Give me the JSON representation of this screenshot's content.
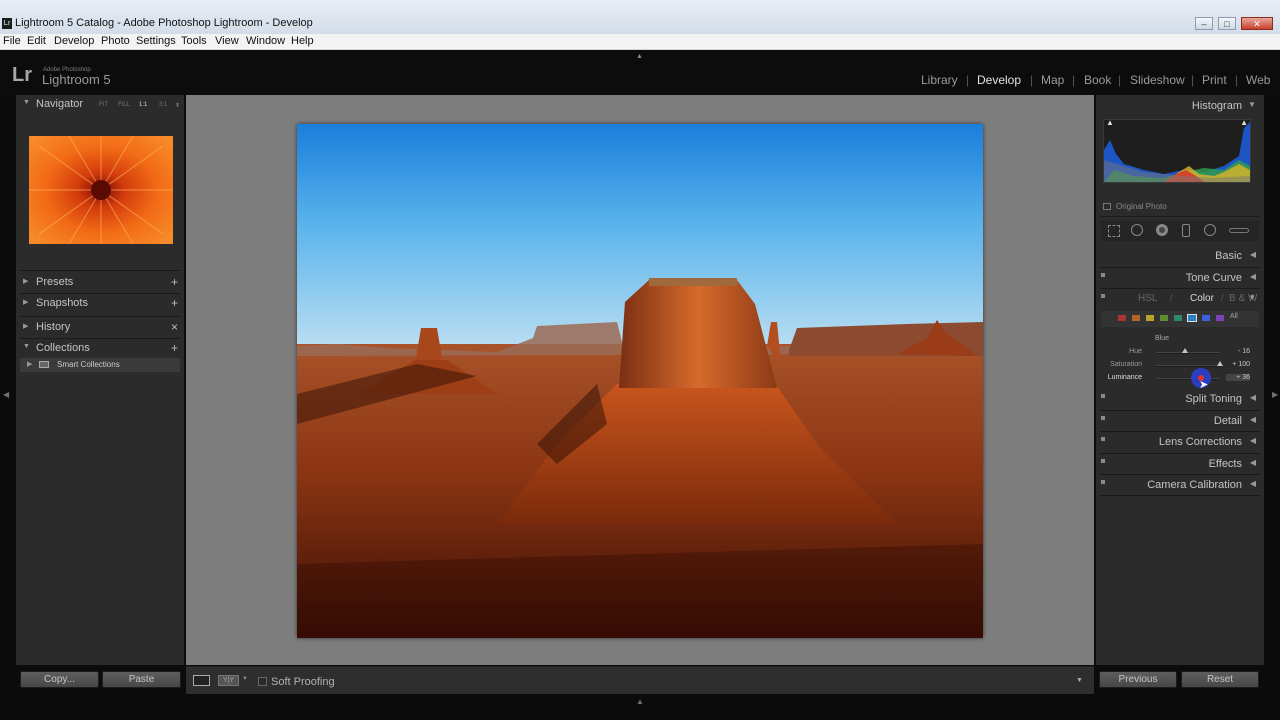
{
  "window": {
    "title": "Lightroom 5 Catalog - Adobe Photoshop Lightroom - Develop",
    "app_icon": "Lr",
    "controls": [
      "minimize",
      "maximize",
      "close"
    ]
  },
  "menu": [
    "File",
    "Edit",
    "Develop",
    "Photo",
    "Settings",
    "Tools",
    "View",
    "Window",
    "Help"
  ],
  "branding": {
    "small": "Adobe Photoshop",
    "name": "Lightroom 5",
    "mark": "Lr"
  },
  "modules": [
    {
      "label": "Library",
      "active": false
    },
    {
      "label": "Develop",
      "active": true
    },
    {
      "label": "Map",
      "active": false
    },
    {
      "label": "Book",
      "active": false
    },
    {
      "label": "Slideshow",
      "active": false
    },
    {
      "label": "Print",
      "active": false
    },
    {
      "label": "Web",
      "active": false
    }
  ],
  "left_panel": {
    "navigator": {
      "title": "Navigator",
      "options": [
        "FIT",
        "FILL",
        "1:1",
        "3:1"
      ],
      "active_option": "1:1"
    },
    "presets": {
      "title": "Presets",
      "action": "+"
    },
    "snapshots": {
      "title": "Snapshots",
      "action": "+"
    },
    "history": {
      "title": "History",
      "action": "×"
    },
    "collections": {
      "title": "Collections",
      "action": "+",
      "items": [
        "Smart Collections"
      ]
    },
    "buttons": {
      "copy": "Copy...",
      "paste": "Paste"
    }
  },
  "toolbar": {
    "soft_proofing": "Soft Proofing",
    "view_mode_icons": [
      "loupe-icon",
      "before-after-icon"
    ]
  },
  "right_panel": {
    "histogram": {
      "title": "Histogram",
      "original_photo": "Original Photo"
    },
    "sections": {
      "basic": "Basic",
      "tone_curve": "Tone Curve",
      "split_toning": "Split Toning",
      "detail": "Detail",
      "lens_corrections": "Lens Corrections",
      "effects": "Effects",
      "camera_calibration": "Camera Calibration"
    },
    "hsl": {
      "tabs": [
        "HSL",
        "Color",
        "B & W"
      ],
      "active_tab": "Color",
      "separator": "/",
      "all_label": "All",
      "selected_color": "Blue",
      "sliders": [
        {
          "label": "Hue",
          "value": "- 16",
          "pos": 0.4
        },
        {
          "label": "Saturation",
          "value": "+ 100",
          "pos": 1.0
        },
        {
          "label": "Luminance",
          "value": "+ 36",
          "pos": 0.68
        }
      ],
      "swatch_colors": [
        "#a33",
        "#b5652a",
        "#b8a52a",
        "#5e8c31",
        "#2e8a6e",
        "#2a7fbf",
        "#3a5fe0",
        "#7a44b5",
        "#a83a86"
      ]
    },
    "buttons": {
      "previous": "Previous",
      "reset": "Reset"
    }
  }
}
